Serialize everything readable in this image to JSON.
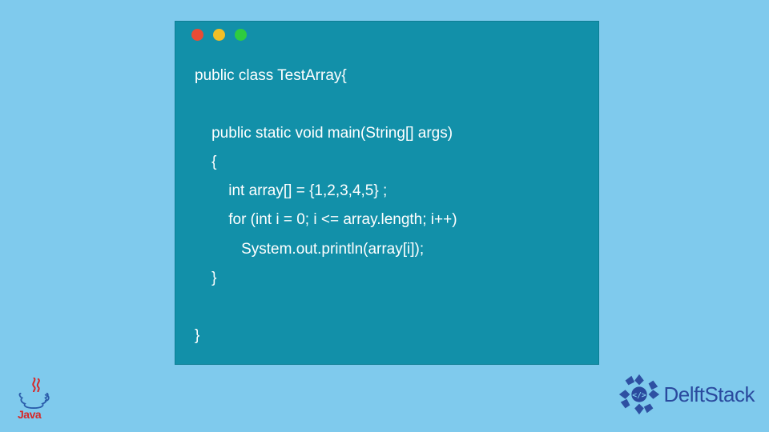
{
  "colors": {
    "page_bg": "#7fcaed",
    "window_bg": "#1290a9",
    "code_text": "#ffffff",
    "dot_red": "#e94b35",
    "dot_yellow": "#f1bf26",
    "dot_green": "#2ecc40",
    "java_red": "#d62828",
    "delft_blue": "#2a4a9e"
  },
  "window": {
    "dots": [
      "red",
      "yellow",
      "green"
    ]
  },
  "code": {
    "lines": [
      "public class TestArray{",
      "",
      "    public static void main(String[] args)",
      "    {",
      "        int array[] = {1,2,3,4,5} ;",
      "        for (int i = 0; i <= array.length; i++)",
      "           System.out.println(array[i]);",
      "    }",
      "",
      "}"
    ]
  },
  "logos": {
    "java_text": "Java",
    "delft_text": "DelftStack"
  }
}
